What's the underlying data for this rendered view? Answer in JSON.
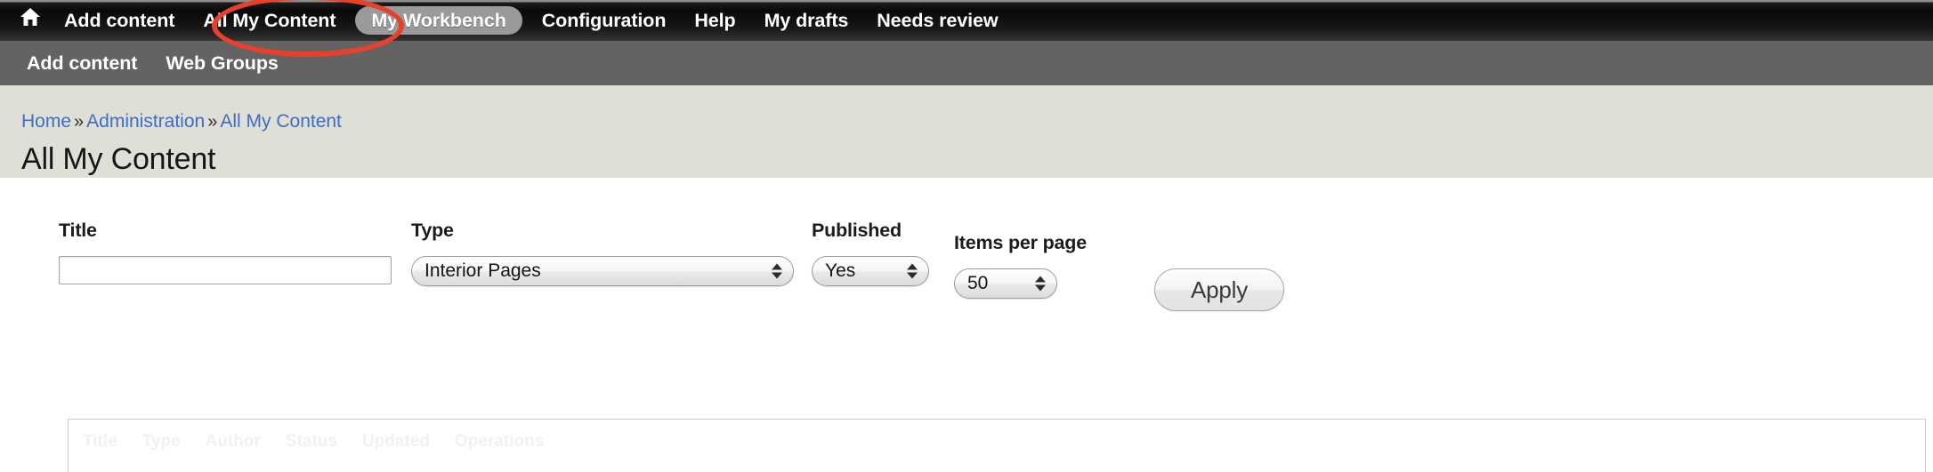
{
  "toolbar": {
    "home_icon": "home-icon",
    "items": [
      {
        "label": "Add content",
        "active": false
      },
      {
        "label": "All My Content",
        "active": false
      },
      {
        "label": "My Workbench",
        "active": true
      },
      {
        "label": "Configuration",
        "active": false
      },
      {
        "label": "Help",
        "active": false
      },
      {
        "label": "My drafts",
        "active": false
      },
      {
        "label": "Needs review",
        "active": false
      }
    ]
  },
  "secondary_nav": {
    "items": [
      {
        "label": "Add content"
      },
      {
        "label": "Web Groups"
      }
    ]
  },
  "breadcrumb": {
    "items": [
      {
        "label": "Home"
      },
      {
        "label": "Administration"
      },
      {
        "label": "All My Content"
      }
    ],
    "separator": "»"
  },
  "page": {
    "title": "All My Content"
  },
  "filters": {
    "title": {
      "label": "Title",
      "value": "",
      "placeholder": ""
    },
    "type": {
      "label": "Type",
      "value": "Interior Pages"
    },
    "published": {
      "label": "Published",
      "value": "Yes"
    },
    "items_per_page": {
      "label": "Items per page",
      "value": "50"
    },
    "apply_label": "Apply"
  },
  "results_table": {
    "columns": [
      "Title",
      "Type",
      "Author",
      "Status",
      "Updated",
      "Operations"
    ]
  },
  "annotation": {
    "shape": "ellipse",
    "color": "#e8402a",
    "targets": "All My Content"
  },
  "colors": {
    "toolbar_bg": "#0d0d0d",
    "secondary_bg": "#636363",
    "head_bg": "#dfdfd8",
    "link": "#3d6ec0",
    "active_pill": "#9a9a9a",
    "annotation": "#e8402a"
  }
}
